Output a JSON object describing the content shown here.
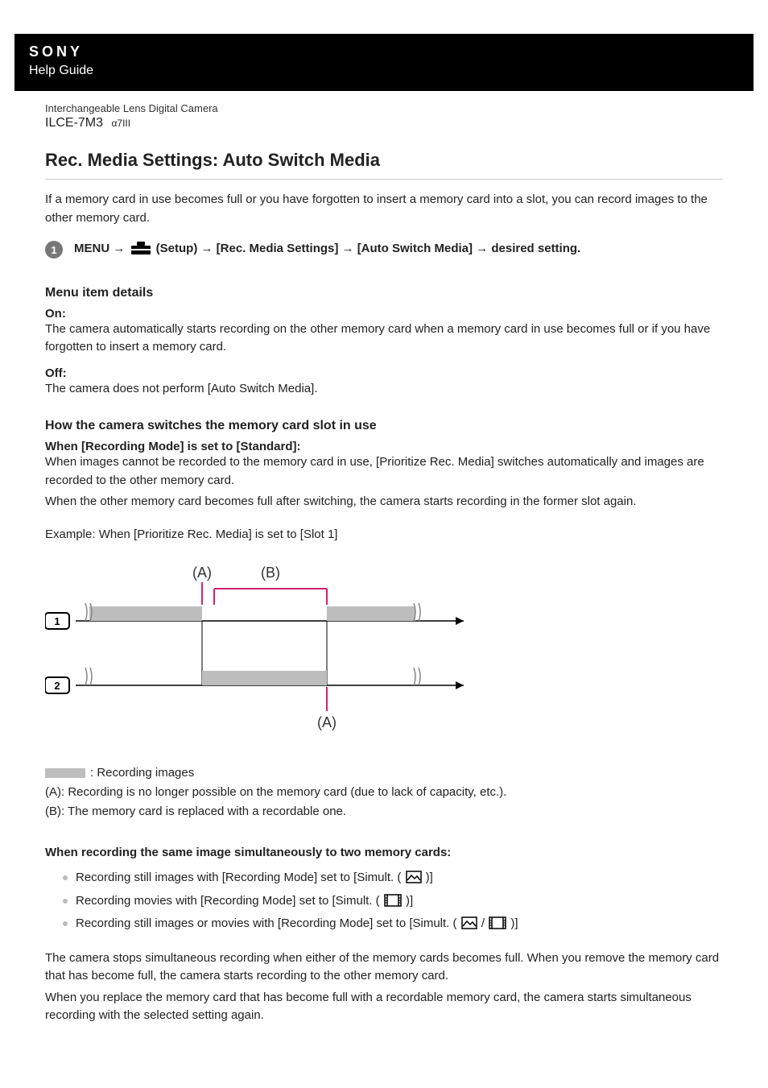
{
  "banner": {
    "brand": "SONY",
    "guide": "Help Guide"
  },
  "meta": {
    "product_type": "Interchangeable Lens Digital Camera",
    "model": "ILCE-7M3",
    "model_suffix": "α7III"
  },
  "title": "Rec. Media Settings: Auto Switch Media",
  "intro": "If a memory card in use becomes full or you have forgotten to insert a memory card into a slot, you can record images to the other memory card.",
  "step": {
    "num": "1",
    "pre": "MENU → ",
    "setup": " (Setup) → [Rec. Media Settings] → [Auto Switch Media] → desired setting."
  },
  "details_heading": "Menu item details",
  "on_label": "On:",
  "on_desc": "The camera automatically starts recording on the other memory card when a memory card in use becomes full or if you have forgotten to insert a memory card.",
  "off_label": "Off:",
  "off_desc": "The camera does not perform [Auto Switch Media].",
  "switch_heading": "How the camera switches the memory card slot in use",
  "standard_label": "When [Recording Mode] is set to [Standard]:",
  "standard_p1": "When images cannot be recorded to the memory card in use, [Prioritize Rec. Media] switches automatically and images are recorded to the other memory card.",
  "standard_p2": "When the other memory card becomes full after switching, the camera starts recording in the former slot again.",
  "example": "Example: When [Prioritize Rec. Media] is set to [Slot 1]",
  "diagram": {
    "A": "(A)",
    "B": "(B)",
    "slot1": "1",
    "slot2": "2"
  },
  "legend": {
    "rec": ": Recording images",
    "A": "(A): Recording is no longer possible on the memory card (due to lack of capacity, etc.).",
    "B": "(B): The memory card is replaced with a recordable one."
  },
  "simul_heading": "When recording the same image simultaneously to two memory cards:",
  "bullets": {
    "b1a": "Recording still images with [Recording Mode] set to [Simult. (",
    "b1b": ")]",
    "b2a": "Recording movies with [Recording Mode] set to [Simult. (",
    "b2b": ")]",
    "b3a": "Recording still images or movies with [Recording Mode] set to [Simult. (",
    "b3b": "/",
    "b3c": ")]"
  },
  "trail_p1": "The camera stops simultaneous recording when either of the memory cards becomes full. When you remove the memory card that has become full, the camera starts recording to the other memory card.",
  "trail_p2": "When you replace the memory card that has become full with a recordable memory card, the camera starts simultaneous recording with the selected setting again."
}
